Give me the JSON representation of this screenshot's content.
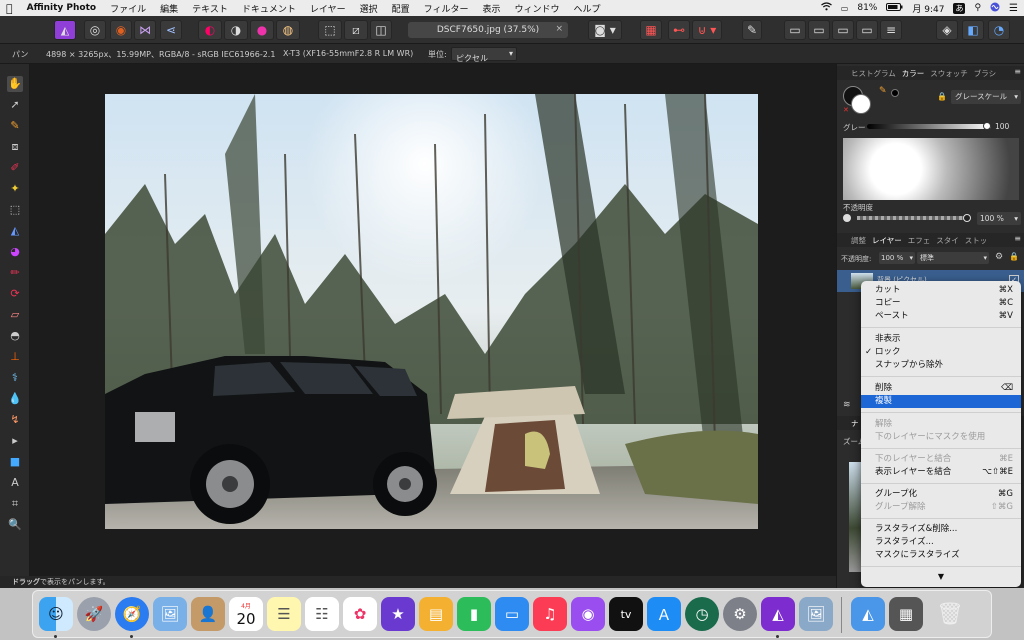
{
  "menubar": {
    "apple": "",
    "items": [
      "Affinity Photo",
      "ファイル",
      "編集",
      "テキスト",
      "ドキュメント",
      "レイヤー",
      "選択",
      "配置",
      "フィルター",
      "表示",
      "ウィンドウ",
      "ヘルプ"
    ],
    "battery": "81%",
    "clock": "月 9:47",
    "input_mode": "あ"
  },
  "toolbar": {
    "doc_title": "DSCF7650.jpg (37.5%)",
    "close_label": "×"
  },
  "context_bar": {
    "tool_name": "パン",
    "image_info": "4898 × 3265px、15.99MP、RGBA/8 - sRGB IEC61966-2.1",
    "camera": "X-T3 (XF16-55mmF2.8 R LM WR)",
    "unit_label": "単位:",
    "unit_value": "ピクセル"
  },
  "status": {
    "bold": "ドラッグ",
    "text": "で表示をパンします。"
  },
  "color_panel": {
    "tabs": [
      "ヒストグラム",
      "カラー",
      "スウォッチ",
      "ブラシ"
    ],
    "active_tab": "カラー",
    "mode": "グレースケール",
    "gray_label": "グレー",
    "gray_value": "100",
    "opacity_label": "不透明度",
    "opacity_value": "100 %"
  },
  "layers_panel": {
    "tabs": [
      "調整",
      "レイヤー",
      "エフェ",
      "スタイ",
      "ストッ"
    ],
    "active_tab": "レイヤー",
    "opacity_label": "不透明度:",
    "opacity_value": "100 %",
    "blend_mode": "標準",
    "layer_name": "背景 (ピクセル)"
  },
  "navigator": {
    "tab": "ナ",
    "zoom_label": "ズーム"
  },
  "context_menu": {
    "items": [
      {
        "label": "カット",
        "shortcut": "⌘X"
      },
      {
        "label": "コピー",
        "shortcut": "⌘C"
      },
      {
        "label": "ペースト",
        "shortcut": "⌘V"
      },
      {
        "label": "非表示",
        "shortcut": ""
      },
      {
        "label": "ロック",
        "shortcut": "",
        "checked": "✓"
      },
      {
        "label": "スナップから除外",
        "shortcut": ""
      },
      {
        "label": "削除",
        "shortcut": "⌫"
      },
      {
        "label": "複製",
        "shortcut": ""
      },
      {
        "label": "解除",
        "shortcut": ""
      },
      {
        "label": "下のレイヤーにマスクを使用",
        "shortcut": ""
      },
      {
        "label": "下のレイヤーと結合",
        "shortcut": "⌘E"
      },
      {
        "label": "表示レイヤーを結合",
        "shortcut": "⌥⇧⌘E"
      },
      {
        "label": "グループ化",
        "shortcut": "⌘G"
      },
      {
        "label": "グループ解除",
        "shortcut": "⇧⌘G"
      },
      {
        "label": "ラスタライズ&削除...",
        "shortcut": ""
      },
      {
        "label": "ラスタライズ...",
        "shortcut": ""
      },
      {
        "label": "マスクにラスタライズ",
        "shortcut": ""
      }
    ],
    "more": "▼"
  },
  "dock": {
    "calendar_month": "4月",
    "calendar_day": "20",
    "tv_label": "tv"
  },
  "colors": {
    "accent": "#1d66d6",
    "affinity_purple": "#8f3fd8"
  }
}
